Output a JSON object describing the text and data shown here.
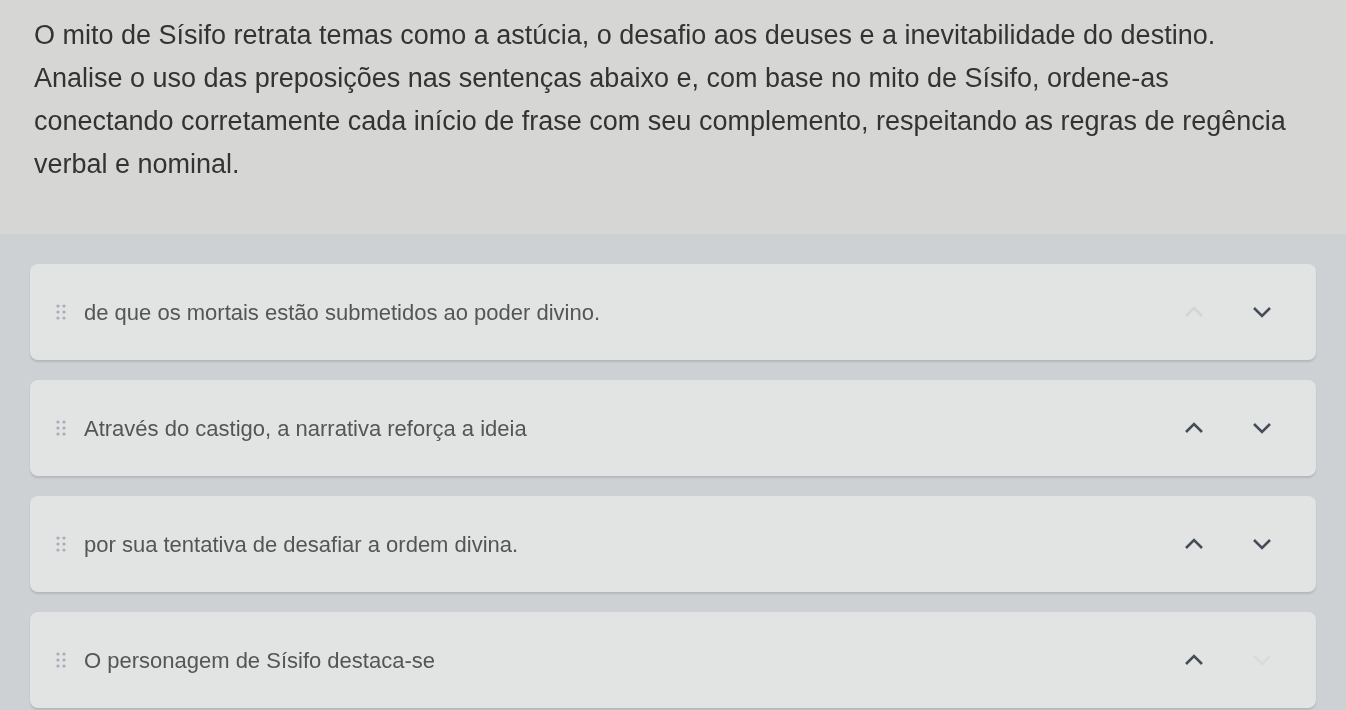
{
  "question": "O mito de Sísifo retrata temas como a astúcia, o desafio aos deuses e a inevitabilidade do destino. Analise o uso das preposições nas sentenças abaixo e, com base no mito de Sísifo, ordene-as conectando corretamente cada início de frase com seu complemento, respeitando as regras de regência verbal e nominal.",
  "items": [
    {
      "text": "de que os mortais estão submetidos ao poder divino.",
      "up_disabled": true,
      "down_disabled": false
    },
    {
      "text": "Através do castigo, a narrativa reforça a ideia",
      "up_disabled": false,
      "down_disabled": false
    },
    {
      "text": "por sua tentativa de desafiar a ordem divina.",
      "up_disabled": false,
      "down_disabled": false
    },
    {
      "text": "O personagem de Sísifo destaca-se",
      "up_disabled": false,
      "down_disabled": true
    }
  ]
}
